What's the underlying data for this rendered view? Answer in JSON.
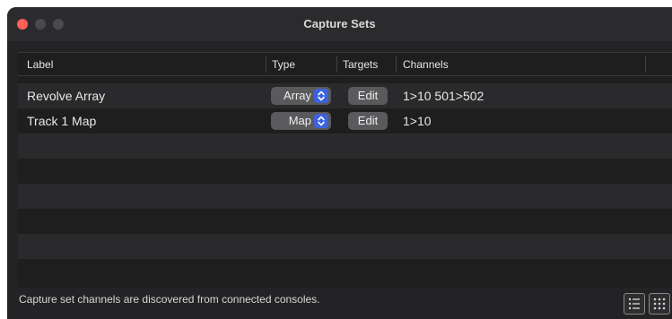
{
  "window": {
    "title": "Capture Sets"
  },
  "table": {
    "columns": [
      "Label",
      "Type",
      "Targets",
      "Channels"
    ],
    "rows": [
      {
        "label": "Revolve Array",
        "type": "Array",
        "targets": "Edit",
        "channels": "1>10 501>502"
      },
      {
        "label": "Track 1 Map",
        "type": "Map",
        "targets": "Edit",
        "channels": "1>10"
      }
    ]
  },
  "footer": {
    "message": "Capture set channels are discovered from connected consoles.",
    "list_view_icon": "list-view-icon",
    "grid_view_icon": "grid-view-icon"
  },
  "colors": {
    "close": "#ff5f57",
    "accent": "#3c62dd",
    "background": "#232325"
  }
}
